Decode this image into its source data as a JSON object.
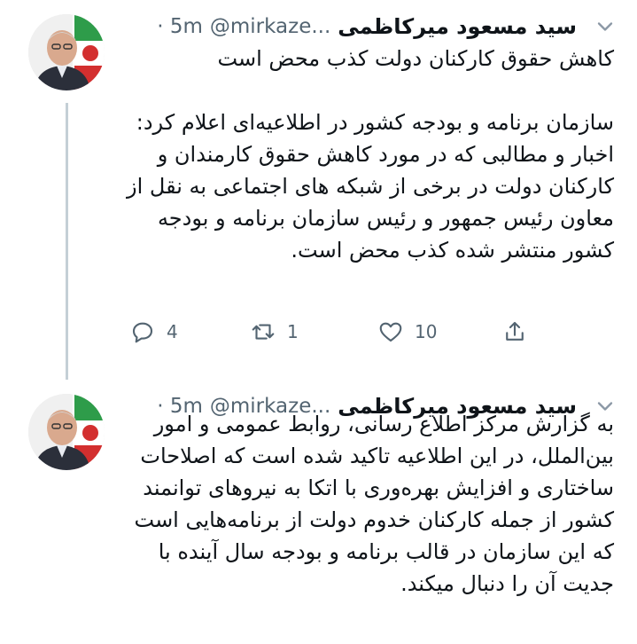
{
  "tweets": [
    {
      "author_name": "سید مسعود میرکاظمی",
      "handle": "@mirkaze...",
      "time": "· 5m",
      "text": "کاهش حقوق کارکنان دولت کذب محض است\n\nسازمان برنامه و بودجه کشور در اطلاعیه‌ای اعلام کرد: اخبار و مطالبی که در مورد کاهش حقوق کارمندان و کارکنان دولت در برخی از شبکه های اجتماعی به نقل از معاون رئیس جمهور و رئیس سازمان برنامه و  بودجه کشور منتشر شده کذب محض است.",
      "replies": "4",
      "retweets": "1",
      "likes": "10"
    },
    {
      "author_name": "سید مسعود میرکاظمی",
      "handle": "@mirkaze...",
      "time": "· 5m",
      "text": "به گزارش مرکز اطلاع رسانی، روابط عمومی و امور بین‌الملل، در این اطلاعیه تاکید شده است که اصلاحات ساختاری و افزایش بهره‌وری با اتکا به نیروهای توانمند کشور از جمله کارکنان خدوم دولت از برنامه‌هایی است که این سازمان در قالب برنامه و بودجه سال  آینده با جدیت آن را دنبال میکند."
    }
  ],
  "icons": {
    "reply": "reply-icon",
    "retweet": "retweet-icon",
    "like": "heart-icon",
    "share": "share-icon",
    "more": "chevron-down-icon"
  },
  "colors": {
    "text": "#0f1419",
    "muted": "#536471",
    "thread_line": "#c4cfd6"
  }
}
